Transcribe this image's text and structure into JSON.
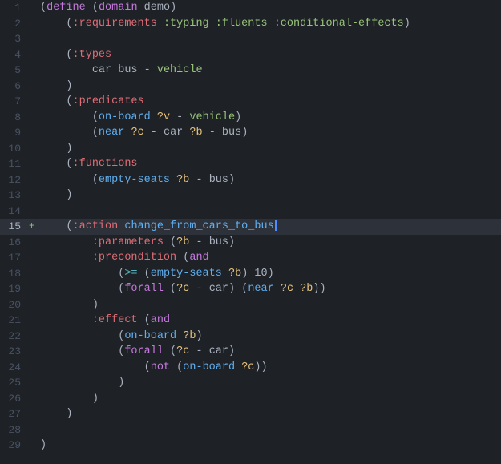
{
  "editor": {
    "background": "#1e2227",
    "lines": [
      {
        "num": 1,
        "highlighted": false,
        "has_plus": false
      },
      {
        "num": 2,
        "highlighted": false,
        "has_plus": false
      },
      {
        "num": 3,
        "highlighted": false,
        "has_plus": false
      },
      {
        "num": 4,
        "highlighted": false,
        "has_plus": false
      },
      {
        "num": 5,
        "highlighted": false,
        "has_plus": false
      },
      {
        "num": 6,
        "highlighted": false,
        "has_plus": false
      },
      {
        "num": 7,
        "highlighted": false,
        "has_plus": false
      },
      {
        "num": 8,
        "highlighted": false,
        "has_plus": false
      },
      {
        "num": 9,
        "highlighted": false,
        "has_plus": false
      },
      {
        "num": 10,
        "highlighted": false,
        "has_plus": false
      },
      {
        "num": 11,
        "highlighted": false,
        "has_plus": false
      },
      {
        "num": 12,
        "highlighted": false,
        "has_plus": false
      },
      {
        "num": 13,
        "highlighted": false,
        "has_plus": false
      },
      {
        "num": 14,
        "highlighted": false,
        "has_plus": false
      },
      {
        "num": 15,
        "highlighted": true,
        "has_plus": true
      },
      {
        "num": 16,
        "highlighted": false,
        "has_plus": false
      },
      {
        "num": 17,
        "highlighted": false,
        "has_plus": false
      },
      {
        "num": 18,
        "highlighted": false,
        "has_plus": false
      },
      {
        "num": 19,
        "highlighted": false,
        "has_plus": false
      },
      {
        "num": 20,
        "highlighted": false,
        "has_plus": false
      },
      {
        "num": 21,
        "highlighted": false,
        "has_plus": false
      },
      {
        "num": 22,
        "highlighted": false,
        "has_plus": false
      },
      {
        "num": 23,
        "highlighted": false,
        "has_plus": false
      },
      {
        "num": 24,
        "highlighted": false,
        "has_plus": false
      },
      {
        "num": 25,
        "highlighted": false,
        "has_plus": false
      },
      {
        "num": 26,
        "highlighted": false,
        "has_plus": false
      },
      {
        "num": 27,
        "highlighted": false,
        "has_plus": false
      },
      {
        "num": 28,
        "highlighted": false,
        "has_plus": false
      },
      {
        "num": 29,
        "highlighted": false,
        "has_plus": false
      }
    ]
  }
}
